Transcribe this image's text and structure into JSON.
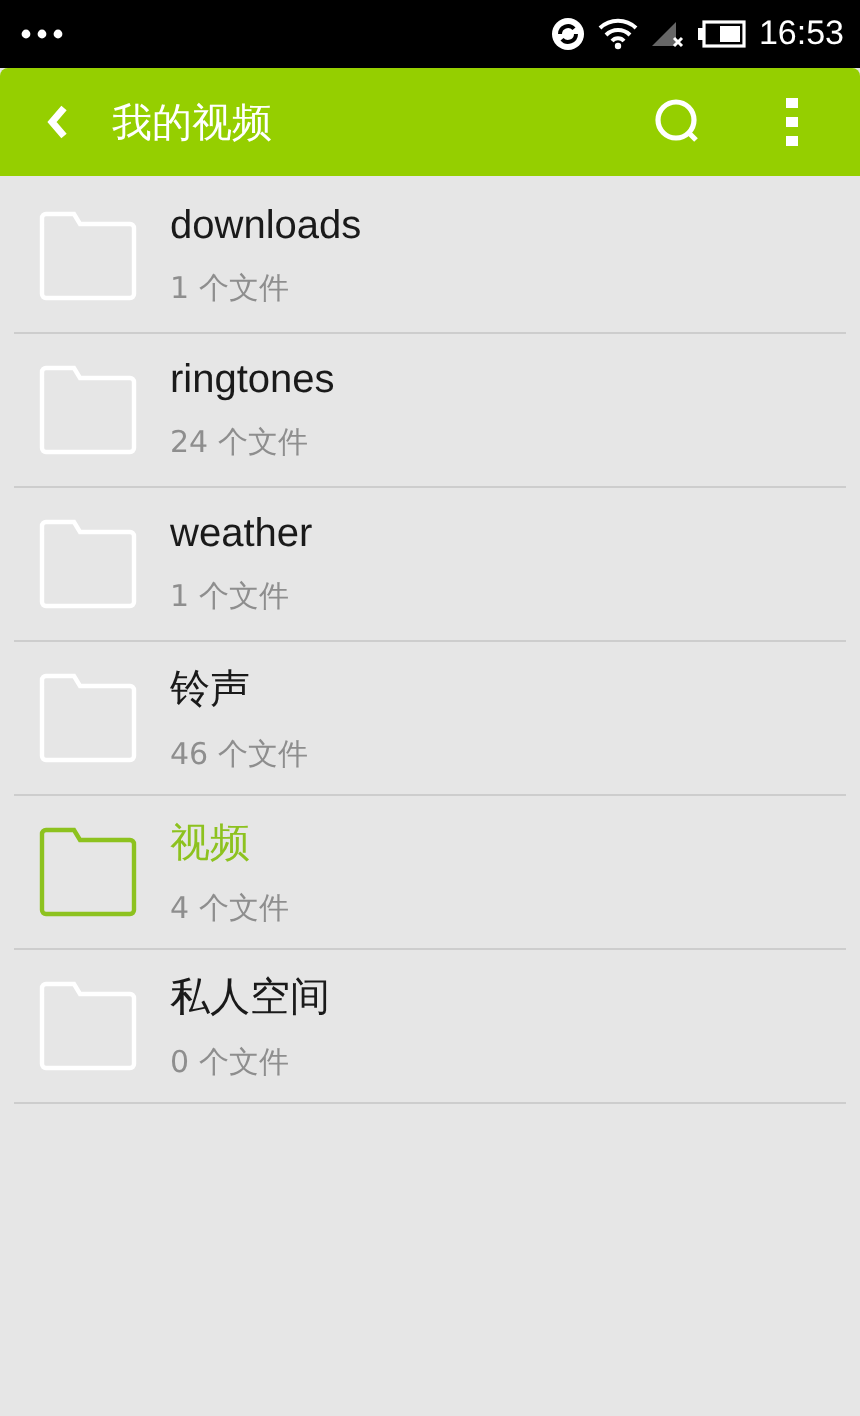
{
  "status_bar": {
    "time": "16:53"
  },
  "app_bar": {
    "title": "我的视频"
  },
  "folders": [
    {
      "name": "downloads",
      "count": "1 个文件",
      "selected": false
    },
    {
      "name": "ringtones",
      "count": "24 个文件",
      "selected": false
    },
    {
      "name": "weather",
      "count": "1 个文件",
      "selected": false
    },
    {
      "name": "铃声",
      "count": "46 个文件",
      "selected": false
    },
    {
      "name": "视频",
      "count": "4 个文件",
      "selected": true
    },
    {
      "name": "私人空间",
      "count": "0 个文件",
      "selected": false
    }
  ]
}
